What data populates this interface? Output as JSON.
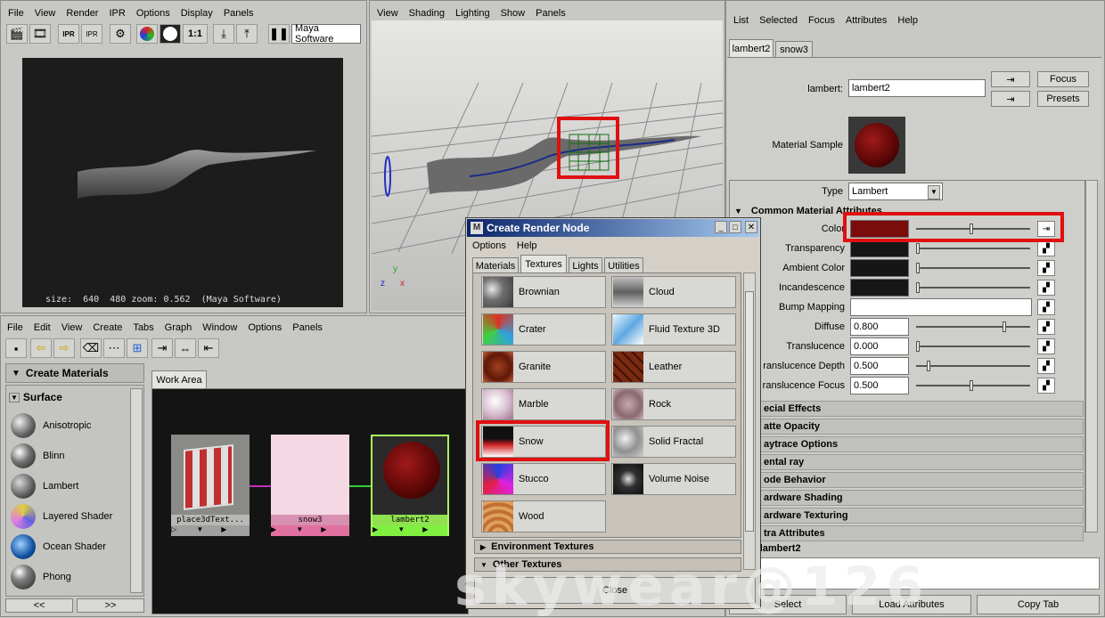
{
  "render_view": {
    "menu": [
      "File",
      "View",
      "Render",
      "IPR",
      "Options",
      "Display",
      "Panels"
    ],
    "toolbar": {
      "ratio_label": "1:1",
      "renderer": "Maya Software"
    },
    "status": "size:  640  480 zoom: 0.562  (Maya Software)"
  },
  "viewport": {
    "menu": [
      "View",
      "Shading",
      "Lighting",
      "Show",
      "Panels"
    ],
    "axis": {
      "x": "x",
      "y": "y",
      "z": "z"
    }
  },
  "attr_editor": {
    "menu": [
      "List",
      "Selected",
      "Focus",
      "Attributes",
      "Help"
    ],
    "tabs": [
      "lambert2",
      "snow3"
    ],
    "node_type_label": "lambert:",
    "node_name": "lambert2",
    "focus_label": "Focus",
    "presets_label": "Presets",
    "sample_label": "Material Sample",
    "type_label": "Type",
    "type_value": "Lambert",
    "section_title": "Common Material Attributes",
    "attributes": [
      {
        "label": "Color",
        "value": ""
      },
      {
        "label": "Transparency",
        "value": ""
      },
      {
        "label": "Ambient Color",
        "value": ""
      },
      {
        "label": "Incandescence",
        "value": ""
      },
      {
        "label": "Bump Mapping",
        "value": ""
      },
      {
        "label": "Diffuse",
        "value": "0.800"
      },
      {
        "label": "Translucence",
        "value": "0.000"
      },
      {
        "label": "ranslucence Depth",
        "value": "0.500"
      },
      {
        "label": "ranslucence Focus",
        "value": "0.500"
      }
    ],
    "sections": [
      "ecial Effects",
      "atte Opacity",
      "aytrace Options",
      "ental ray",
      "ode Behavior",
      "ardware Shading",
      "ardware Texturing",
      "tra Attributes"
    ],
    "notes": ": lambert2",
    "bottom_buttons": [
      "Select",
      "Load Attributes",
      "Copy Tab"
    ],
    "colors": {
      "color": "#7a0c0c",
      "dark": "#161616"
    }
  },
  "hypershade": {
    "menu": [
      "File",
      "Edit",
      "View",
      "Create",
      "Tabs",
      "Graph",
      "Window",
      "Options",
      "Panels"
    ],
    "create_header": "Create Materials",
    "surface_header": "Surface",
    "materials": [
      "Anisotropic",
      "Blinn",
      "Lambert",
      "Layered Shader",
      "Ocean Shader",
      "Phong"
    ],
    "work_area_tab": "Work Area",
    "nodes": [
      "place3dText...",
      "snow3",
      "lambert2"
    ],
    "nav": [
      "<<",
      ">>"
    ]
  },
  "render_node": {
    "title": "Create Render Node",
    "menu": [
      "Options",
      "Help"
    ],
    "tabs": [
      "Materials",
      "Textures",
      "Lights",
      "Utilities"
    ],
    "textures": [
      [
        "Brownian",
        "Cloud"
      ],
      [
        "Crater",
        "Fluid Texture 3D"
      ],
      [
        "Granite",
        "Leather"
      ],
      [
        "Marble",
        "Rock"
      ],
      [
        "Snow",
        "Solid Fractal"
      ],
      [
        "Stucco",
        "Volume Noise"
      ],
      [
        "Wood",
        ""
      ]
    ],
    "collapsed": [
      "Environment Textures",
      "Other Textures"
    ],
    "close_label": "Close"
  },
  "watermark": "skywear@126"
}
